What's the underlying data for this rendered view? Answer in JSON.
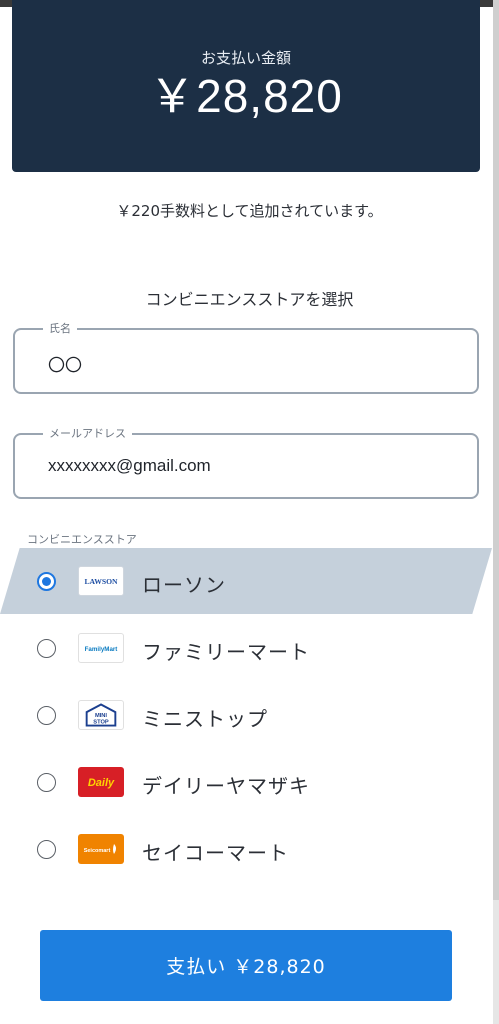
{
  "payment": {
    "amount_label": "お支払い金額",
    "amount_value": "￥28,820",
    "fee_note": "￥220手数料として追加されています。"
  },
  "store_select": {
    "heading": "コンビニエンスストアを選択"
  },
  "form": {
    "name": {
      "legend": "氏名",
      "value": "〇〇"
    },
    "email": {
      "legend": "メールアドレス",
      "value": "xxxxxxxx@gmail.com"
    }
  },
  "stores": {
    "section_label": "コンビニエンスストア",
    "items": [
      {
        "name": "ローソン",
        "logo_text": "LAWSON",
        "selected": true
      },
      {
        "name": "ファミリーマート",
        "logo_text": "FamilyMart",
        "selected": false
      },
      {
        "name": "ミニストップ",
        "logo_text": "MINI STOP",
        "selected": false
      },
      {
        "name": "デイリーヤマザキ",
        "logo_text": "Daily",
        "selected": false
      },
      {
        "name": "セイコーマート",
        "logo_text": "Seicomart",
        "selected": false
      }
    ]
  },
  "pay_button": {
    "label": "支払い ￥28,820"
  },
  "colors": {
    "panel": "#1c2f45",
    "accent": "#1e7fdf",
    "selected_row": "#c5d0db",
    "radio_on": "#1e77e0"
  }
}
